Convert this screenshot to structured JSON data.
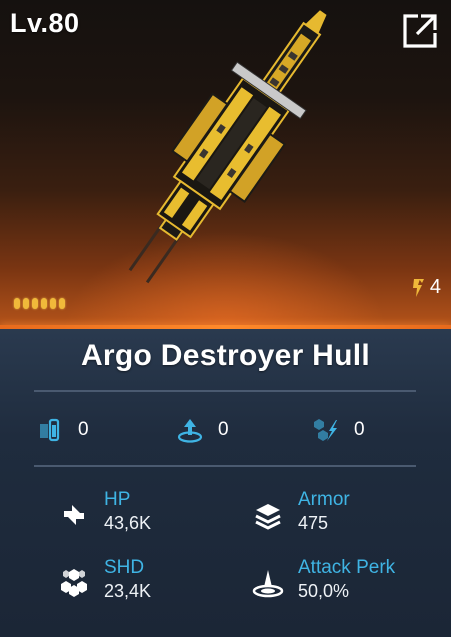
{
  "header": {
    "level": "Lv.80",
    "tier": "4",
    "stars": 6
  },
  "item": {
    "name": "Argo Destroyer Hull"
  },
  "mods": [
    {
      "icon": "module-slot-icon",
      "count": "0"
    },
    {
      "icon": "upgrade-arrow-icon",
      "count": "0"
    },
    {
      "icon": "augment-gem-icon",
      "count": "0"
    }
  ],
  "stats": [
    {
      "icon": "hp-icon",
      "label": "HP",
      "value": "43,6K"
    },
    {
      "icon": "armor-icon",
      "label": "Armor",
      "value": "475"
    },
    {
      "icon": "shield-hex-icon",
      "label": "SHD",
      "value": "23,4K"
    },
    {
      "icon": "attack-perk-icon",
      "label": "Attack Perk",
      "value": "50,0%"
    }
  ],
  "colors": {
    "accent": "#3fb4e4",
    "star": "#f0b93a",
    "tier": "#f0b93a",
    "glow": "#ff8a2a"
  }
}
